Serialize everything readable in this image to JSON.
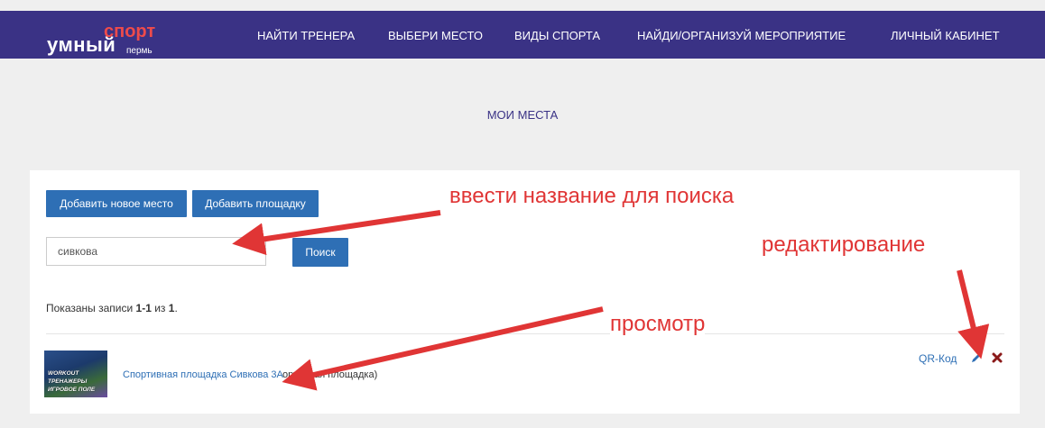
{
  "brand": {
    "word": "умный",
    "sport": "спорт",
    "city": "пермь"
  },
  "nav": {
    "items": [
      {
        "label": "НАЙТИ ТРЕНЕРА"
      },
      {
        "label": "ВЫБЕРИ МЕСТО"
      },
      {
        "label": "ВИДЫ СПОРТА"
      },
      {
        "label": "НАЙДИ/ОРГАНИЗУЙ МЕРОПРИЯТИЕ"
      },
      {
        "label": "ЛИЧНЫЙ КАБИНЕТ"
      }
    ]
  },
  "page": {
    "title": "МОИ МЕСТА"
  },
  "toolbar": {
    "add_place_label": "Добавить новое место",
    "add_ground_label": "Добавить площадку"
  },
  "search": {
    "value": "сивкова",
    "button_label": "Поиск"
  },
  "summary": {
    "prefix": "Показаны записи ",
    "range": "1-1",
    "middle": " из ",
    "total": "1",
    "suffix": "."
  },
  "items": [
    {
      "thumb_lines": [
        "WORKOUT",
        "ТРЕНАЖЕРЫ",
        "ИГРОВОЕ ПОЛЕ"
      ],
      "name": "Спортивная площадка Сивкова 3А",
      "type_fragment": "ортивная площадка)",
      "qr_label": "QR-Код",
      "edit_icon": "pencil-icon",
      "delete_icon": "close-x-icon"
    }
  ],
  "annotations": {
    "search_hint": "ввести  название для поиска",
    "edit_hint": "редактирование",
    "view_hint": "просмотр",
    "color": "#e03535"
  },
  "colors": {
    "navbar": "#3a3285",
    "accent": "#2e6fb5",
    "logo_red": "#ee4b4b",
    "background": "#efefef"
  }
}
